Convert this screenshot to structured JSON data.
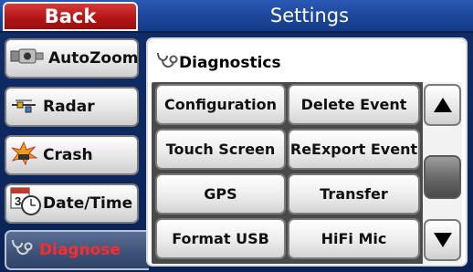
{
  "header": {
    "back_label": "Back",
    "title": "Settings"
  },
  "sidebar": {
    "items": [
      {
        "label": "AutoZoom",
        "icon": "camera-icon"
      },
      {
        "label": "Radar",
        "icon": "radar-icon"
      },
      {
        "label": "Crash",
        "icon": "crash-icon"
      },
      {
        "label": "Date/Time",
        "icon": "calendar-clock-icon"
      },
      {
        "label": "Diagnose",
        "icon": "stethoscope-icon",
        "selected": true
      }
    ]
  },
  "panel": {
    "heading": "Diagnostics",
    "heading_icon": "stethoscope-icon",
    "buttons": [
      "Configuration",
      "Delete Event",
      "Touch Screen",
      "ReExport Event",
      "GPS",
      "Transfer",
      "Format USB",
      "HiFi Mic"
    ]
  },
  "scroll": {
    "up_icon": "triangle-up-icon",
    "down_icon": "triangle-down-icon"
  },
  "colors": {
    "selected_text": "#ff2a2a",
    "back_button": "#b51616",
    "topbar": "#1c4699"
  }
}
